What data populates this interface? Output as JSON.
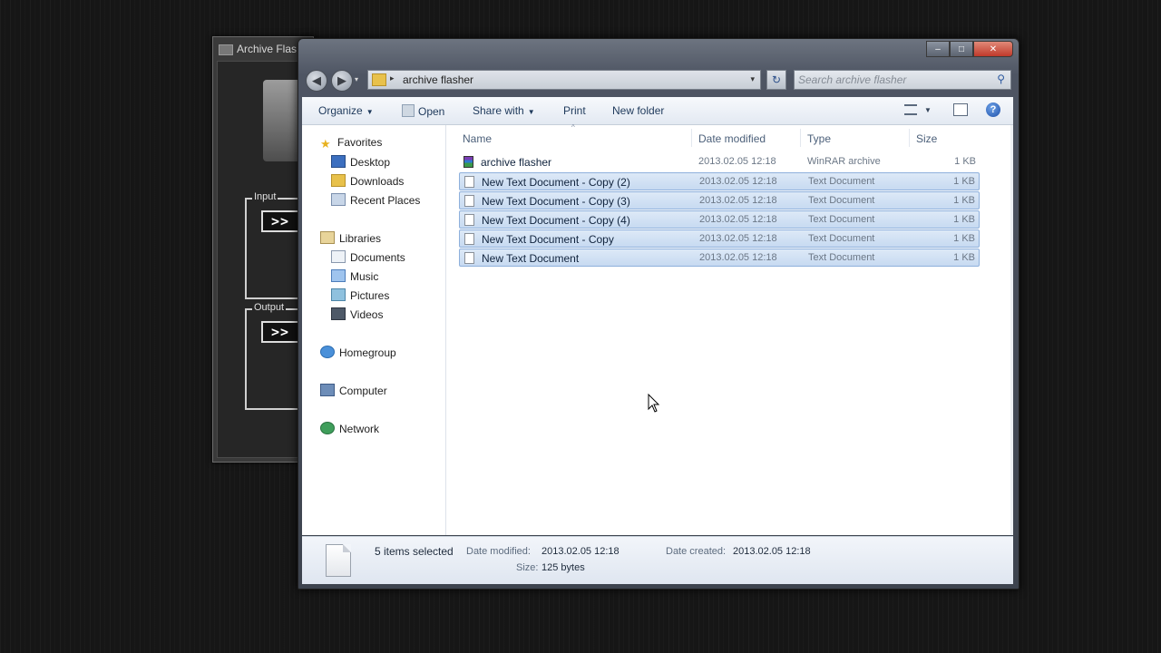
{
  "background_app": {
    "title": "Archive Flas",
    "input_label": "Input",
    "output_label": "Output",
    "input_button": ">>",
    "output_button": ">>"
  },
  "explorer": {
    "caption_buttons": {
      "minimize": "–",
      "maximize": "□",
      "close": "✕"
    },
    "nav_buttons": {
      "back": "◀",
      "forward": "▶",
      "recent": "▾"
    },
    "address": {
      "arrow": "▸",
      "path": "archive flasher",
      "dropdown": "▾"
    },
    "refresh_symbol": "↻",
    "search": {
      "placeholder": "Search archive flasher",
      "icon": "⚲"
    },
    "toolbar": {
      "organize": "Organize",
      "open": "Open",
      "share_with": "Share with",
      "print": "Print",
      "new_folder": "New folder",
      "caret": "▼",
      "help": "?"
    },
    "nav_pane": {
      "favorites": "Favorites",
      "desktop": "Desktop",
      "downloads": "Downloads",
      "recent_places": "Recent Places",
      "libraries": "Libraries",
      "documents": "Documents",
      "music": "Music",
      "pictures": "Pictures",
      "videos": "Videos",
      "homegroup": "Homegroup",
      "computer": "Computer",
      "network": "Network",
      "star": "★"
    },
    "columns": {
      "name": "Name",
      "date_modified": "Date modified",
      "type": "Type",
      "size": "Size",
      "sort_indicator": "^"
    },
    "files": [
      {
        "name": "archive flasher",
        "date": "2013.02.05 12:18",
        "type": "WinRAR archive",
        "size": "1 KB",
        "selected": false
      },
      {
        "name": "New Text Document - Copy (2)",
        "date": "2013.02.05 12:18",
        "type": "Text Document",
        "size": "1 KB",
        "selected": true
      },
      {
        "name": "New Text Document - Copy (3)",
        "date": "2013.02.05 12:18",
        "type": "Text Document",
        "size": "1 KB",
        "selected": true
      },
      {
        "name": "New Text Document - Copy (4)",
        "date": "2013.02.05 12:18",
        "type": "Text Document",
        "size": "1 KB",
        "selected": true
      },
      {
        "name": "New Text Document - Copy",
        "date": "2013.02.05 12:18",
        "type": "Text Document",
        "size": "1 KB",
        "selected": true
      },
      {
        "name": "New Text Document",
        "date": "2013.02.05 12:18",
        "type": "Text Document",
        "size": "1 KB",
        "selected": true
      }
    ],
    "details": {
      "count": "5 items selected",
      "date_modified_label": "Date modified:",
      "date_modified_value": "2013.02.05 12:18",
      "date_created_label": "Date created:",
      "date_created_value": "2013.02.05 12:18",
      "size_label": "Size:",
      "size_value": "125 bytes"
    }
  }
}
